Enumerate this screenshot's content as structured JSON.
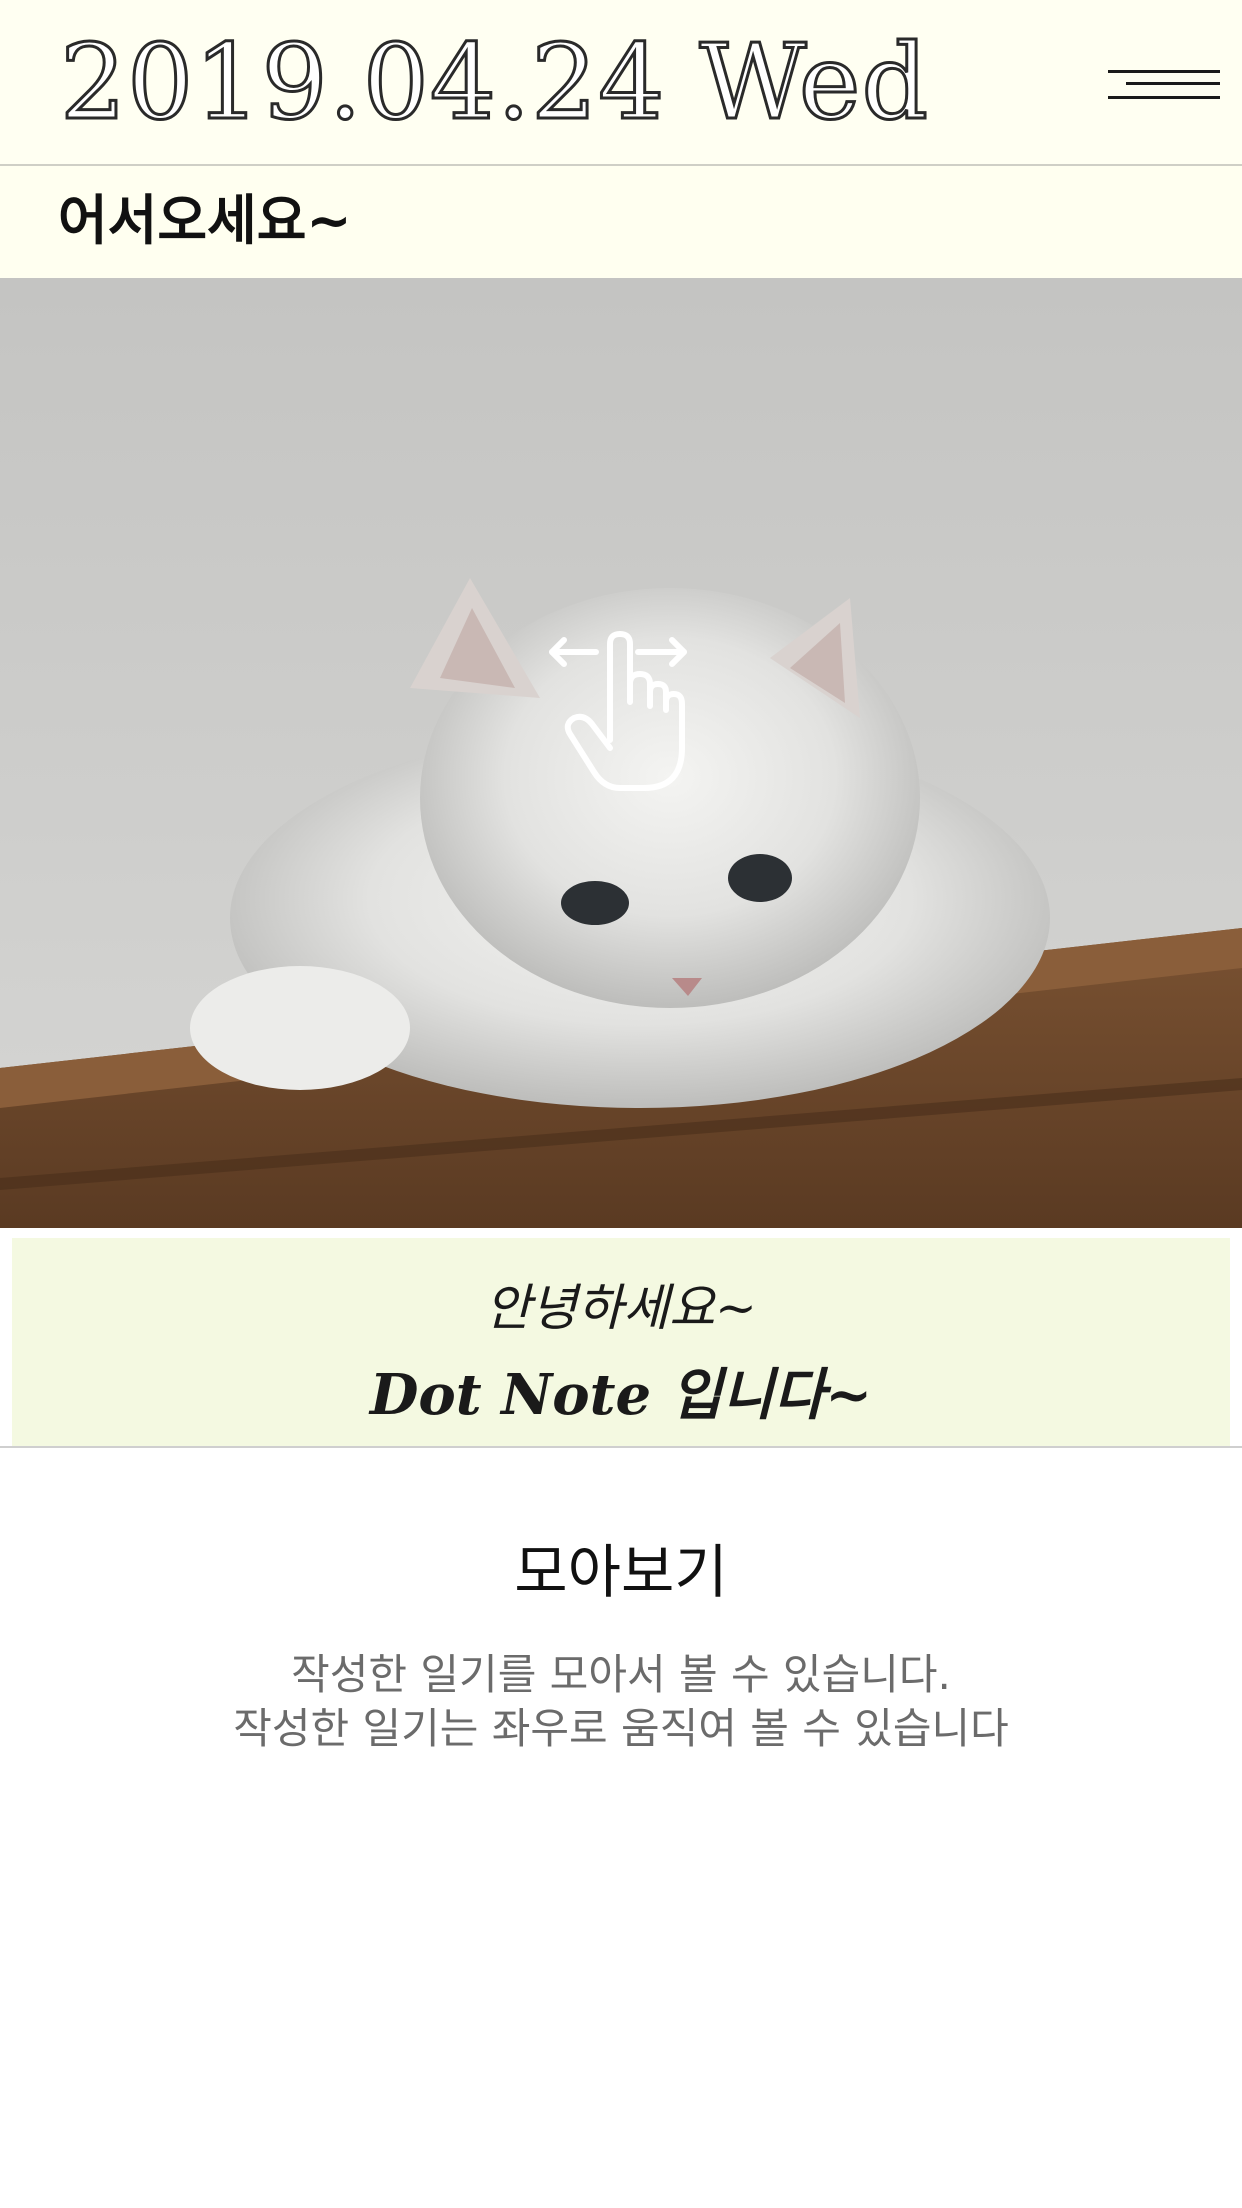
{
  "header": {
    "date": "2019.04.24 Wed",
    "menu_icon": "hamburger-menu-icon"
  },
  "welcome": {
    "text": "어서오세요~"
  },
  "hero": {
    "image": "cat-photo",
    "overlay_icon": "swipe-hand-icon"
  },
  "greeting": {
    "line1": "안녕하세요~",
    "line2": "Dot Note 입니다~"
  },
  "section": {
    "title": "모아보기",
    "desc1": "작성한 일기를 모아서 볼 수 있습니다.",
    "desc2": "작성한 일기는 좌우로 움직여 볼 수 있습니다"
  },
  "colors": {
    "header_bg": "#fffff2",
    "greeting_bg": "#f4f9e1",
    "desc_text": "#6b6b6b"
  }
}
